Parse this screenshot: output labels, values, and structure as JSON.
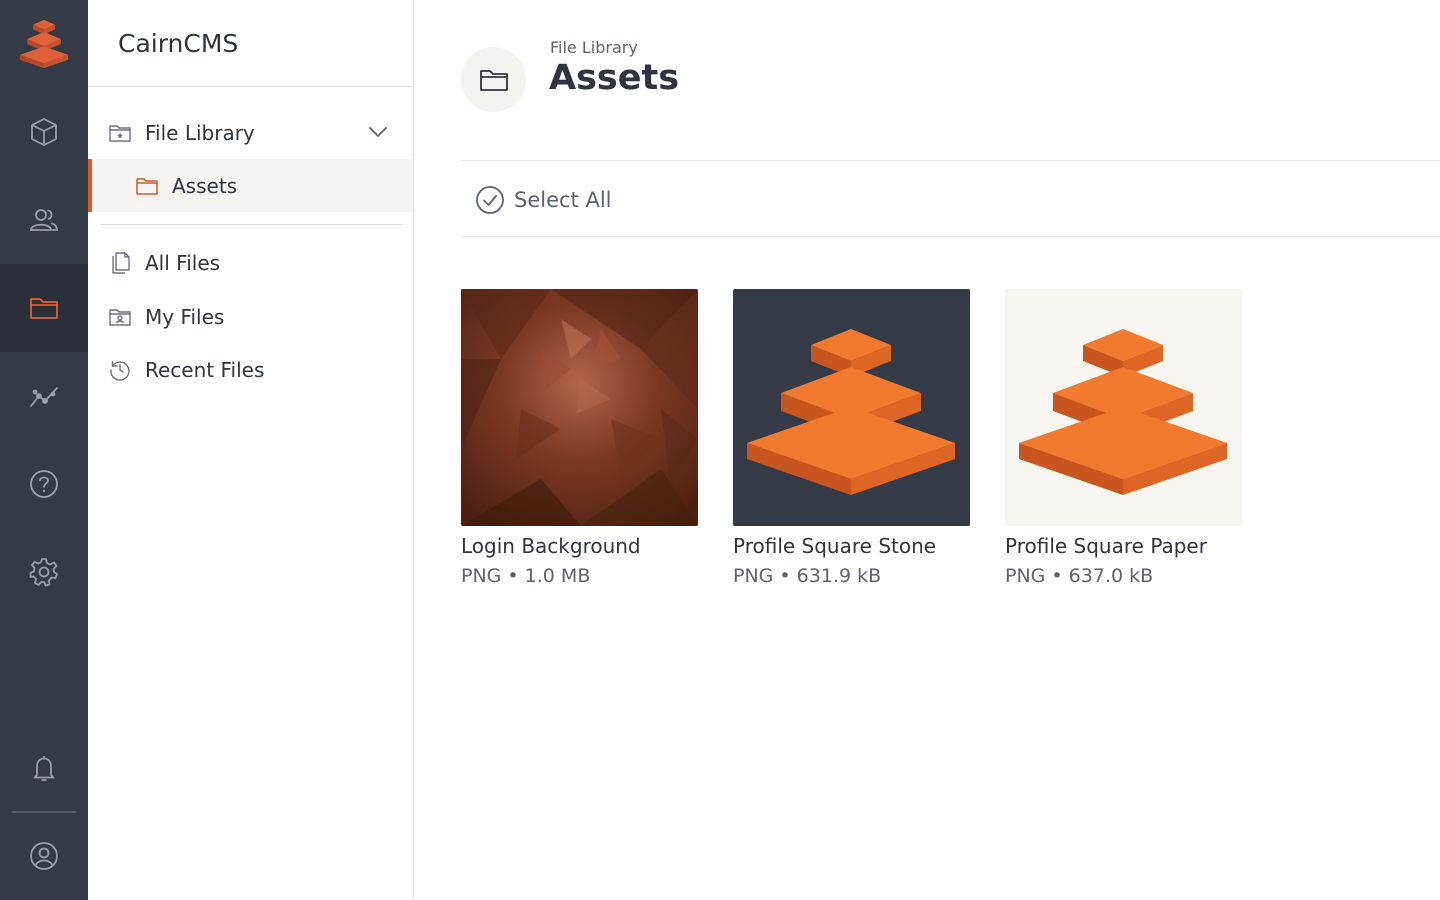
{
  "app": {
    "name": "CairnCMS"
  },
  "rail": {
    "items": [
      {
        "icon": "cairn-logo-icon"
      },
      {
        "icon": "cube-icon"
      },
      {
        "icon": "users-icon"
      },
      {
        "icon": "folder-icon",
        "active": true
      },
      {
        "icon": "analytics-icon"
      },
      {
        "icon": "help-icon"
      },
      {
        "icon": "settings-gear-icon"
      },
      {
        "icon": "bell-icon"
      },
      {
        "icon": "account-icon"
      }
    ]
  },
  "sidebar": {
    "file_library": {
      "label": "File Library",
      "icon": "folder-star-icon",
      "expanded": true
    },
    "assets": {
      "label": "Assets",
      "icon": "folder-icon"
    },
    "all_files": {
      "label": "All Files",
      "icon": "files-icon"
    },
    "my_files": {
      "label": "My Files",
      "icon": "folder-user-icon"
    },
    "recent_files": {
      "label": "Recent Files",
      "icon": "history-icon"
    }
  },
  "header": {
    "breadcrumb": "File Library",
    "title": "Assets",
    "icon": "folder-icon"
  },
  "toolbar": {
    "select_all_label": "Select All"
  },
  "files": [
    {
      "name": "Login Background",
      "meta": "PNG • 1.0 MB"
    },
    {
      "name": "Profile Square Stone",
      "meta": "PNG • 631.9 kB"
    },
    {
      "name": "Profile Square Paper",
      "meta": "PNG • 637.0 kB"
    }
  ],
  "colors": {
    "accent": "#cf5a33",
    "rail_bg": "#353b46",
    "rail_active": "#2a2f38",
    "text": "#2e3541"
  }
}
